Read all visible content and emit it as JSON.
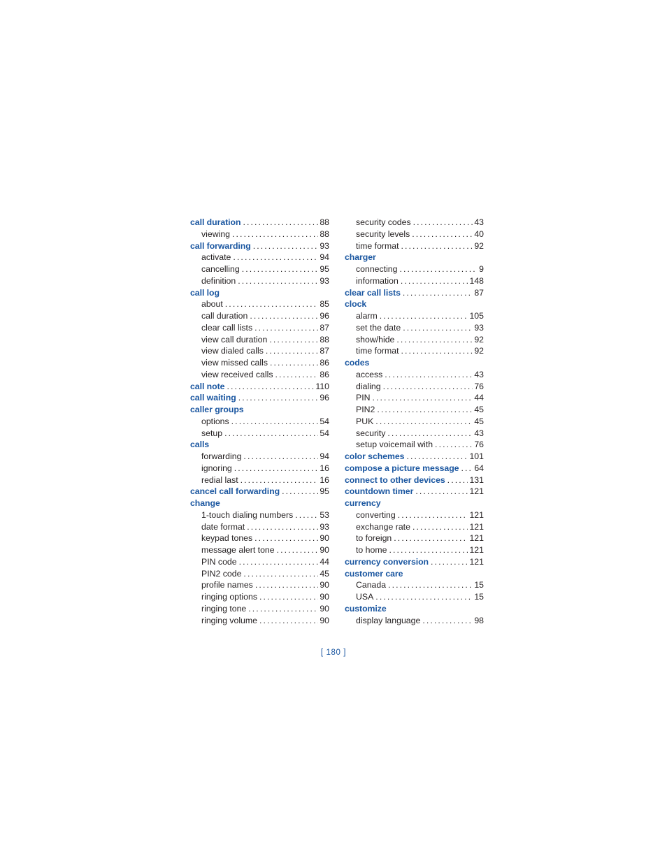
{
  "document": {
    "page_label": "[ 180 ]",
    "accent_color": "#1a56a0",
    "body_color": "#231f20"
  },
  "columns": [
    {
      "name": "left-column",
      "entries": [
        {
          "label": "call duration",
          "page": "88",
          "level": 0
        },
        {
          "label": "viewing",
          "page": "88",
          "level": 1
        },
        {
          "label": "call forwarding",
          "page": "93",
          "level": 0
        },
        {
          "label": "activate",
          "page": "94",
          "level": 1
        },
        {
          "label": "cancelling",
          "page": "95",
          "level": 1
        },
        {
          "label": "definition",
          "page": "93",
          "level": 1
        },
        {
          "label": "call log",
          "page": "",
          "level": 0
        },
        {
          "label": "about",
          "page": "85",
          "level": 1
        },
        {
          "label": "call duration",
          "page": "96",
          "level": 1
        },
        {
          "label": "clear call lists",
          "page": "87",
          "level": 1
        },
        {
          "label": "view call duration",
          "page": "88",
          "level": 1
        },
        {
          "label": "view dialed calls",
          "page": "87",
          "level": 1
        },
        {
          "label": "view missed calls",
          "page": "86",
          "level": 1
        },
        {
          "label": "view received calls",
          "page": "86",
          "level": 1
        },
        {
          "label": "call note",
          "page": "110",
          "level": 0
        },
        {
          "label": "call waiting",
          "page": "96",
          "level": 0
        },
        {
          "label": "caller groups",
          "page": "",
          "level": 0
        },
        {
          "label": "options",
          "page": "54",
          "level": 1
        },
        {
          "label": "setup",
          "page": "54",
          "level": 1
        },
        {
          "label": "calls",
          "page": "",
          "level": 0
        },
        {
          "label": "forwarding",
          "page": "94",
          "level": 1
        },
        {
          "label": "ignoring",
          "page": "16",
          "level": 1
        },
        {
          "label": "redial last",
          "page": "16",
          "level": 1
        },
        {
          "label": "cancel call forwarding",
          "page": "95",
          "level": 0
        },
        {
          "label": "change",
          "page": "",
          "level": 0
        },
        {
          "label": "1-touch dialing numbers",
          "page": "53",
          "level": 1
        },
        {
          "label": "date format",
          "page": "93",
          "level": 1
        },
        {
          "label": "keypad tones",
          "page": "90",
          "level": 1
        },
        {
          "label": "message alert tone",
          "page": "90",
          "level": 1
        },
        {
          "label": "PIN code",
          "page": "44",
          "level": 1
        },
        {
          "label": "PIN2 code",
          "page": "45",
          "level": 1
        },
        {
          "label": "profile names",
          "page": "90",
          "level": 1
        },
        {
          "label": "ringing options",
          "page": "90",
          "level": 1
        },
        {
          "label": "ringing tone",
          "page": "90",
          "level": 1
        },
        {
          "label": "ringing volume",
          "page": "90",
          "level": 1
        }
      ]
    },
    {
      "name": "right-column",
      "entries": [
        {
          "label": "security codes",
          "page": "43",
          "level": 1
        },
        {
          "label": "security levels",
          "page": "40",
          "level": 1
        },
        {
          "label": "time format",
          "page": "92",
          "level": 1
        },
        {
          "label": "charger",
          "page": "",
          "level": 0
        },
        {
          "label": "connecting",
          "page": "9",
          "level": 1
        },
        {
          "label": "information",
          "page": "148",
          "level": 1
        },
        {
          "label": "clear call lists",
          "page": "87",
          "level": 0
        },
        {
          "label": "clock",
          "page": "",
          "level": 0
        },
        {
          "label": "alarm",
          "page": "105",
          "level": 1
        },
        {
          "label": "set the date",
          "page": "93",
          "level": 1
        },
        {
          "label": "show/hide",
          "page": "92",
          "level": 1
        },
        {
          "label": "time format",
          "page": "92",
          "level": 1
        },
        {
          "label": "codes",
          "page": "",
          "level": 0
        },
        {
          "label": "access",
          "page": "43",
          "level": 1
        },
        {
          "label": "dialing",
          "page": "76",
          "level": 1
        },
        {
          "label": "PIN",
          "page": "44",
          "level": 1
        },
        {
          "label": "PIN2",
          "page": "45",
          "level": 1
        },
        {
          "label": "PUK",
          "page": "45",
          "level": 1
        },
        {
          "label": "security",
          "page": "43",
          "level": 1
        },
        {
          "label": "setup voicemail with",
          "page": "76",
          "level": 1
        },
        {
          "label": "color schemes",
          "page": "101",
          "level": 0
        },
        {
          "label": "compose a picture message",
          "page": "64",
          "level": 0
        },
        {
          "label": "connect to other devices",
          "page": "131",
          "level": 0
        },
        {
          "label": "countdown timer",
          "page": "121",
          "level": 0
        },
        {
          "label": "currency",
          "page": "",
          "level": 0
        },
        {
          "label": "converting",
          "page": "121",
          "level": 1
        },
        {
          "label": "exchange rate",
          "page": "121",
          "level": 1
        },
        {
          "label": "to foreign",
          "page": "121",
          "level": 1
        },
        {
          "label": "to home",
          "page": "121",
          "level": 1
        },
        {
          "label": "currency conversion",
          "page": "121",
          "level": 0
        },
        {
          "label": "customer care",
          "page": "",
          "level": 0
        },
        {
          "label": "Canada",
          "page": "15",
          "level": 1
        },
        {
          "label": "USA",
          "page": "15",
          "level": 1
        },
        {
          "label": "customize",
          "page": "",
          "level": 0
        },
        {
          "label": "display language",
          "page": "98",
          "level": 1
        }
      ]
    }
  ]
}
